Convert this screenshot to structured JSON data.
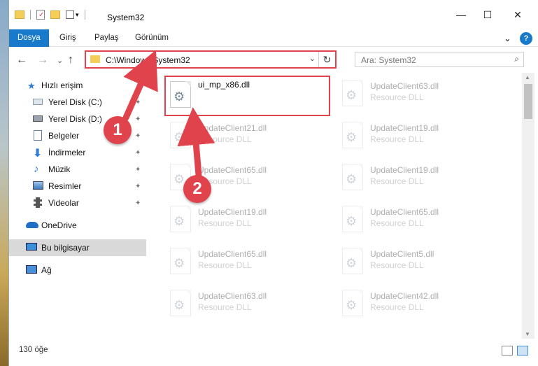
{
  "window": {
    "title": "System32",
    "controls": {
      "minimize": "—",
      "maximize": "☐",
      "close": "✕"
    }
  },
  "ribbon": {
    "tabs": [
      "Dosya",
      "Giriş",
      "Paylaş",
      "Görünüm"
    ],
    "expand": "⌄",
    "help": "?"
  },
  "nav": {
    "back": "←",
    "forward": "→",
    "recent": "⌄",
    "up": "↑",
    "address": "C:\\Windows\\System32",
    "address_dropdown": "⌄",
    "refresh": "↻",
    "search_placeholder": "Ara: System32",
    "search_icon": "⌕"
  },
  "sidebar": {
    "items": [
      {
        "label": "Hızlı erişim",
        "icon": "star-icon"
      },
      {
        "label": "Yerel Disk (C:)",
        "icon": "drive-icon",
        "pinned": true
      },
      {
        "label": "Yerel Disk (D:)",
        "icon": "drive-icon",
        "pinned": true
      },
      {
        "label": "Belgeler",
        "icon": "documents-icon",
        "pinned": true
      },
      {
        "label": "İndirmeler",
        "icon": "download-icon",
        "pinned": true
      },
      {
        "label": "Müzik",
        "icon": "music-icon",
        "pinned": true
      },
      {
        "label": "Resimler",
        "icon": "pictures-icon",
        "pinned": true
      },
      {
        "label": "Videolar",
        "icon": "video-icon",
        "pinned": true
      },
      {
        "label": "OneDrive",
        "icon": "cloud-icon"
      },
      {
        "label": "Bu bilgisayar",
        "icon": "computer-icon",
        "selected": true
      },
      {
        "label": "Ağ",
        "icon": "network-icon"
      }
    ],
    "pin_glyph": "📌"
  },
  "files": {
    "highlighted": {
      "name": "ui_mp_x86.dll",
      "type": ""
    },
    "left_column": [
      {
        "name": "UpdateClient21.dll",
        "type": "Resource DLL"
      },
      {
        "name": "UpdateClient65.dll",
        "type": "Resource DLL"
      },
      {
        "name": "UpdateClient19.dll",
        "type": "Resource DLL"
      },
      {
        "name": "UpdateClient65.dll",
        "type": "Resource DLL"
      },
      {
        "name": "UpdateClient63.dll",
        "type": "Resource DLL"
      }
    ],
    "right_column": [
      {
        "name": "UpdateClient63.dll",
        "type": "Resource DLL"
      },
      {
        "name": "UpdateClient19.dll",
        "type": "Resource DLL"
      },
      {
        "name": "UpdateClient19.dll",
        "type": "Resource DLL"
      },
      {
        "name": "UpdateClient65.dll",
        "type": "Resource DLL"
      },
      {
        "name": "UpdateClient5.dll",
        "type": "Resource DLL"
      },
      {
        "name": "UpdateClient42.dll",
        "type": "Resource DLL"
      }
    ]
  },
  "status": {
    "count": "130 öğe"
  },
  "annotations": {
    "step1": "1",
    "step2": "2"
  },
  "colors": {
    "accent": "#1979ca",
    "annotation": "#e0434b",
    "folder": "#f5cd59"
  }
}
